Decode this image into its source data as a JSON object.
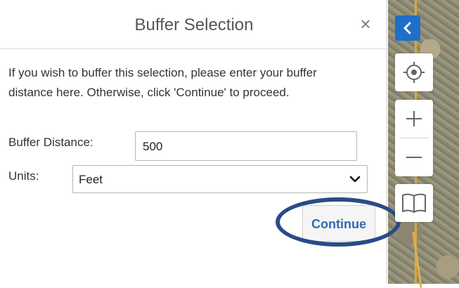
{
  "dialog": {
    "title": "Buffer Selection",
    "close_glyph": "×",
    "intro": "If you wish to buffer this selection, please enter your buffer distance here. Otherwise, click 'Continue' to proceed.",
    "buffer_distance_label": "Buffer Distance:",
    "buffer_distance_value": "500",
    "units_label": "Units:",
    "units_selected": "Feet",
    "continue_label": "Continue"
  },
  "map_controls": {
    "icons": [
      "chevron-left-icon",
      "locate-icon",
      "zoom-in-icon",
      "zoom-out-icon",
      "book-icon"
    ]
  },
  "colors": {
    "accent": "#1f6fc8",
    "button_text": "#2f6bb0",
    "highlight_ring": "#2b4b86"
  }
}
